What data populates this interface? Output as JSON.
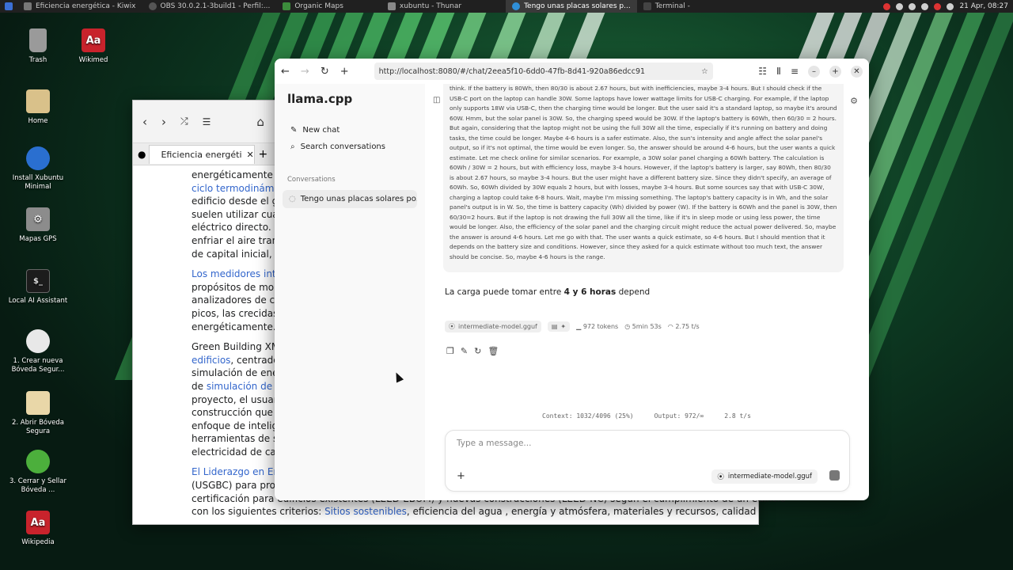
{
  "taskbar": {
    "tasks": [
      {
        "label": "Eficiencia energética - Kiwix",
        "active": false
      },
      {
        "label": "OBS 30.0.2.1-3build1 - Perfil:...",
        "active": false
      },
      {
        "label": "Organic Maps",
        "active": false
      },
      {
        "label": "xubuntu - Thunar",
        "active": false
      },
      {
        "label": "Tengo unas placas solares p...",
        "active": true
      },
      {
        "label": "Terminal -",
        "active": false
      }
    ],
    "clock": "21 Apr, 08:27"
  },
  "desktop": {
    "icons": [
      {
        "label": "Trash",
        "icon": "trash-icon"
      },
      {
        "label": "Wikimed",
        "icon": "dictionary-icon"
      },
      {
        "label": "Home",
        "icon": "folder-icon"
      },
      {
        "label": "Install Xubuntu Minimal",
        "icon": "installer-icon"
      },
      {
        "label": "Mapas GPS",
        "icon": "gear-icon"
      },
      {
        "label": "Local AI Assistant",
        "icon": "terminal-icon"
      },
      {
        "label": "1. Crear nueva Bóveda Segur...",
        "icon": "lock-icon"
      },
      {
        "label": "2. Abrir Bóveda Segura",
        "icon": "folder-icon"
      },
      {
        "label": "3. Cerrar y Sellar Bóveda ...",
        "icon": "padlock-icon"
      },
      {
        "label": "Wikipedia",
        "icon": "dictionary-icon"
      }
    ]
  },
  "kiwix": {
    "tab_title": "Eficiencia energéti",
    "paragraphs": [
      [
        {
          "t": "energéticamente y re"
        }
      ],
      [
        {
          "t": "ciclo termodinámico",
          "link": true
        }
      ],
      [
        {
          "t": "edificio desde el gran"
        }
      ],
      [
        {
          "t": "suelen utilizar cuatro"
        }
      ],
      [
        {
          "t": "eléctrico directo. Otra"
        }
      ],
      [
        {
          "t": "enfriar el aire transfir"
        }
      ],
      [
        {
          "t": "de capital inicial, pero"
        }
      ]
    ],
    "p2": [
      [
        {
          "t": "Los medidores intelig",
          "link": true
        }
      ],
      [
        {
          "t": "propósitos de monito"
        }
      ],
      [
        {
          "t": "analizadores de calid"
        }
      ],
      [
        {
          "t": "picos, las crecidas y l"
        }
      ],
      [
        {
          "t": "energéticamente. A n"
        }
      ]
    ],
    "p3": [
      [
        {
          "t": "Green Building XML ("
        }
      ],
      [
        {
          "t": "edificios",
          "link": true
        },
        {
          "t": ", centrado en"
        }
      ],
      [
        {
          "t": "simulación de energí"
        }
      ],
      [
        {
          "t": "de "
        },
        {
          "t": "simulación de ren",
          "link": true
        }
      ],
      [
        {
          "t": "proyecto, el usuario c"
        }
      ],
      [
        {
          "t": "construcción que tie"
        }
      ],
      [
        {
          "t": "enfoque de inteligen"
        }
      ],
      [
        {
          "t": "herramientas de sim"
        }
      ],
      [
        {
          "t": "electricidad de calefa"
        }
      ]
    ],
    "p4": [
      [
        {
          "t": "El Liderazgo en Energ",
          "link": true
        }
      ],
      [
        {
          "t": "(USGBC) para promov"
        }
      ],
      [
        {
          "t": "certificación para edificios existentes (LEED-EBOM) y nuevas construcciones (LEED-NC) según el cumplimiento de un edificio"
        }
      ],
      [
        {
          "t": "con los siguientes criterios: "
        },
        {
          "t": "Sitios sostenibles",
          "link": true
        },
        {
          "t": ", eficiencia del agua , energía y atmósfera, materiales y recursos, calidad"
        }
      ]
    ]
  },
  "browser": {
    "url": "http://localhost:8080/#/chat/2eea5f10-6dd0-47fb-8d41-920a86edcc91"
  },
  "app": {
    "brand": "llama.cpp",
    "new_chat": "New chat",
    "search": "Search conversations",
    "conversations_label": "Conversations",
    "conversation_title": "Tengo unas placas solares po...",
    "thinking": "think. If the battery is 80Wh, then 80/30 is about 2.67 hours, but with inefficiencies, maybe 3-4 hours. But I should check if the USB-C port on the laptop can handle 30W. Some laptops have lower wattage limits for USB-C charging. For example, if the laptop only supports 18W via USB-C, then the charging time would be longer. But the user said it's a standard laptop, so maybe it's around 60W. Hmm, but the solar panel is 30W. So, the charging speed would be 30W. If the laptop's battery is 60Wh, then 60/30 = 2 hours. But again, considering that the laptop might not be using the full 30W all the time, especially if it's running on battery and doing tasks, the time could be longer. Maybe 4-6 hours is a safer estimate. Also, the sun's intensity and angle affect the solar panel's output, so if it's not optimal, the time would be even longer. So, the answer should be around 4-6 hours, but the user wants a quick estimate. Let me check online for similar scenarios. For example, a 30W solar panel charging a 60Wh battery. The calculation is 60Wh / 30W = 2 hours, but with efficiency loss, maybe 3-4 hours. However, if the laptop's battery is larger, say 80Wh, then 80/30 is about 2.67 hours, so maybe 3-4 hours. But the user might have a different battery size. Since they didn't specify, an average of 60Wh. So, 60Wh divided by 30W equals 2 hours, but with losses, maybe 3-4 hours. But some sources say that with USB-C 30W, charging a laptop could take 6-8 hours. Wait, maybe I'm missing something. The laptop's battery capacity is in Wh, and the solar panel's output is in W. So, the time is battery capacity (Wh) divided by power (W). If the battery is 60Wh and the panel is 30W, then 60/30=2 hours. But if the laptop is not drawing the full 30W all the time, like if it's in sleep mode or using less power, the time would be longer. Also, the efficiency of the solar panel and the charging circuit might reduce the actual power delivered. So, maybe the answer is around 4-6 hours. Let me go with that. The user wants a quick estimate, so 4-6 hours. But I should mention that it depends on the battery size and conditions. However, since they asked for a quick estimate without too much text, the answer should be concise. So, maybe 4-6 hours is the range.",
    "answer_prefix": "La carga puede tomar entre ",
    "answer_bold": "4 y 6 horas",
    "answer_suffix": " depend",
    "model_name": "intermediate-model.gguf",
    "tokens": "972 tokens",
    "duration": "5min 53s",
    "speed": "2.75 t/s",
    "context": "Context: 1032/4096 (25%)",
    "output": "Output: 972/∞",
    "rate": "2.8 t/s",
    "composer_placeholder": "Type a message..."
  }
}
